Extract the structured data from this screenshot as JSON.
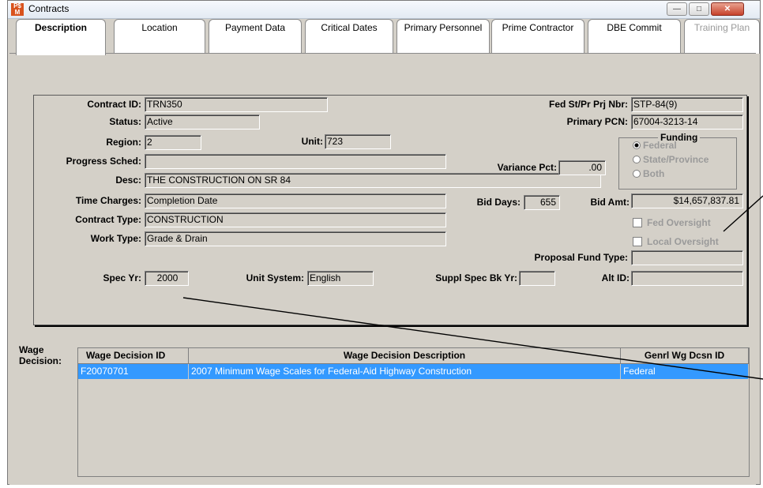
{
  "window": {
    "title": "Contracts",
    "icon_text": "P$M"
  },
  "tabs": [
    {
      "label": "Description"
    },
    {
      "label": "Location"
    },
    {
      "label": "Payment Data"
    },
    {
      "label": "Critical Dates"
    },
    {
      "label": "Primary Personnel"
    },
    {
      "label": "Prime Contractor"
    },
    {
      "label": "DBE Commit"
    },
    {
      "label": "Training Plan"
    }
  ],
  "form": {
    "contract_id": {
      "label": "Contract ID:",
      "value": "TRN350"
    },
    "status": {
      "label": "Status:",
      "value": "Active"
    },
    "region": {
      "label": "Region:",
      "value": "2"
    },
    "unit": {
      "label": "Unit:",
      "value": "723"
    },
    "progress_sched": {
      "label": "Progress Sched:",
      "value": ""
    },
    "desc": {
      "label": "Desc:",
      "value": "THE CONSTRUCTION ON SR 84"
    },
    "time_charges": {
      "label": "Time Charges:",
      "value": "Completion Date"
    },
    "contract_type": {
      "label": "Contract Type:",
      "value": "CONSTRUCTION"
    },
    "work_type": {
      "label": "Work Type:",
      "value": "Grade & Drain"
    },
    "spec_yr": {
      "label": "Spec Yr:",
      "value": "2000"
    },
    "unit_system": {
      "label": "Unit System:",
      "value": "English"
    },
    "suppl_spec": {
      "label": "Suppl Spec Bk Yr:",
      "value": ""
    },
    "alt_id": {
      "label": "Alt ID:",
      "value": ""
    },
    "fed_prj": {
      "label": "Fed St/Pr Prj Nbr:",
      "value": "STP-84(9)"
    },
    "primary_pcn": {
      "label": "Primary PCN:",
      "value": "67004-3213-14"
    },
    "variance_pct": {
      "label": "Variance Pct:",
      "value": ".00"
    },
    "bid_days": {
      "label": "Bid Days:",
      "value": "655"
    },
    "bid_amt": {
      "label": "Bid Amt:",
      "value": "$14,657,837.81"
    },
    "proposal_fund_type": {
      "label": "Proposal Fund Type:",
      "value": ""
    }
  },
  "funding": {
    "title": "Funding",
    "options": [
      {
        "label": "Federal",
        "selected": true
      },
      {
        "label": "State/Province",
        "selected": false
      },
      {
        "label": "Both",
        "selected": false
      }
    ]
  },
  "checkboxes": {
    "fed_oversight": {
      "label": "Fed Oversight",
      "checked": false
    },
    "local_oversight": {
      "label": "Local Oversight",
      "checked": false
    }
  },
  "wage": {
    "section_label_1": "Wage",
    "section_label_2": "Decision:",
    "columns": [
      "Wage Decision ID",
      "Wage Decision Description",
      "Genrl Wg Dcsn ID"
    ],
    "rows": [
      {
        "id": "F20070701",
        "description": "2007 Minimum Wage Scales for Federal-Aid Highway Construction",
        "general": "Federal",
        "selected": true
      }
    ]
  },
  "colors": {
    "selection": "#3399ff",
    "form_bg": "#d4d0c8",
    "close_button": "#c6412b"
  }
}
